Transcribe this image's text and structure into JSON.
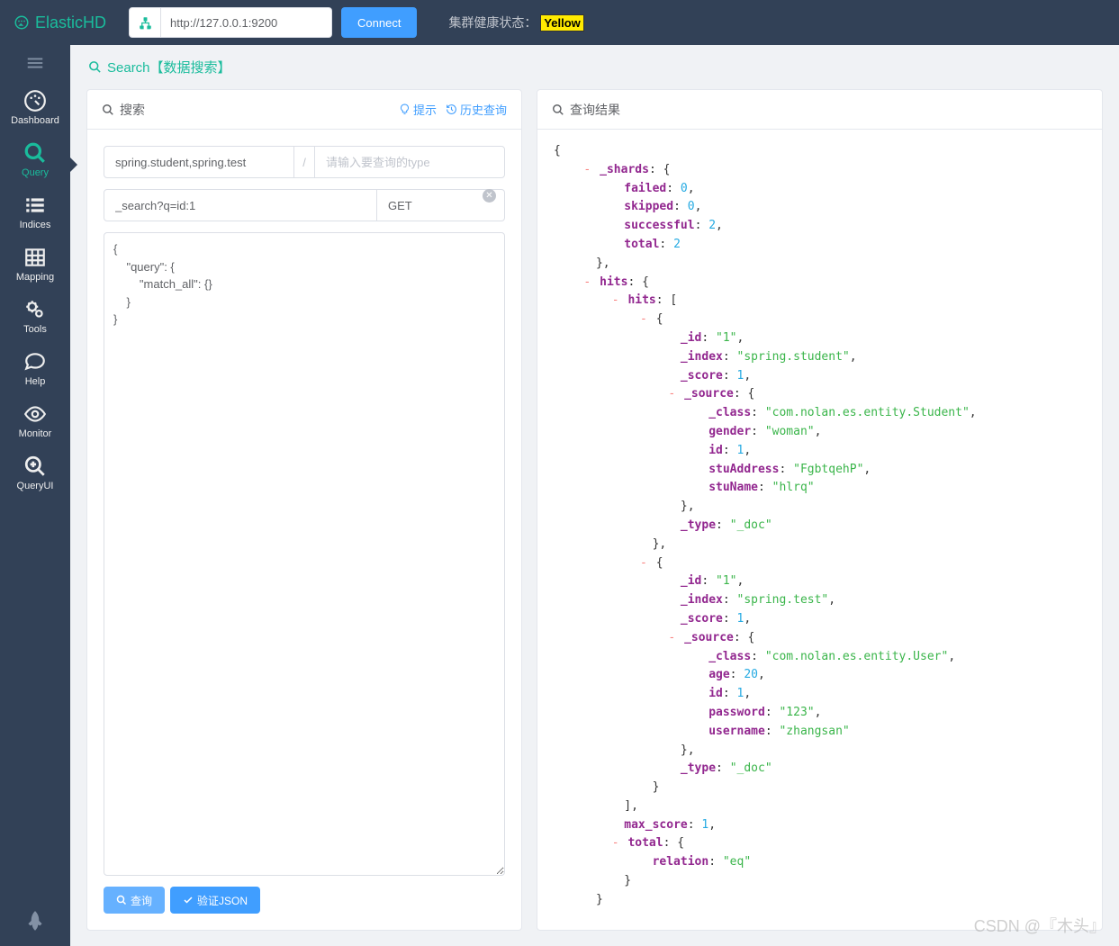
{
  "brand": "ElasticHD",
  "connection": {
    "url": "http://127.0.0.1:9200",
    "connect_label": "Connect"
  },
  "health": {
    "label": "集群健康状态：",
    "status": "Yellow"
  },
  "sidebar": {
    "items": [
      {
        "label": "Dashboard"
      },
      {
        "label": "Query"
      },
      {
        "label": "Indices"
      },
      {
        "label": "Mapping"
      },
      {
        "label": "Tools"
      },
      {
        "label": "Help"
      },
      {
        "label": "Monitor"
      },
      {
        "label": "QueryUI"
      }
    ]
  },
  "page": {
    "title": "Search【数据搜索】"
  },
  "search_panel": {
    "title": "搜索",
    "hint_link": "提示",
    "history_link": "历史查询",
    "index_value": "spring.student,spring.test",
    "separator": "/",
    "type_placeholder": "请输入要查询的type",
    "path_value": "_search?q=id:1",
    "method": "GET",
    "query_body": "{\n    \"query\": {\n        \"match_all\": {}\n    }\n}",
    "search_btn": "查询",
    "validate_btn": "验证JSON"
  },
  "result_panel": {
    "title": "查询结果"
  },
  "result_json": {
    "_shards": {
      "failed": 0,
      "skipped": 0,
      "successful": 2,
      "total": 2
    },
    "hits": {
      "hits": [
        {
          "_id": "1",
          "_index": "spring.student",
          "_score": 1,
          "_source": {
            "_class": "com.nolan.es.entity.Student",
            "gender": "woman",
            "id": 1,
            "stuAddress": "FgbtqehP",
            "stuName": "hlrq"
          },
          "_type": "_doc"
        },
        {
          "_id": "1",
          "_index": "spring.test",
          "_score": 1,
          "_source": {
            "_class": "com.nolan.es.entity.User",
            "age": 20,
            "id": 1,
            "password": "123",
            "username": "zhangsan"
          },
          "_type": "_doc"
        }
      ],
      "max_score": 1,
      "total": {
        "relation": "eq"
      }
    }
  },
  "watermark": "CSDN @『木头』"
}
